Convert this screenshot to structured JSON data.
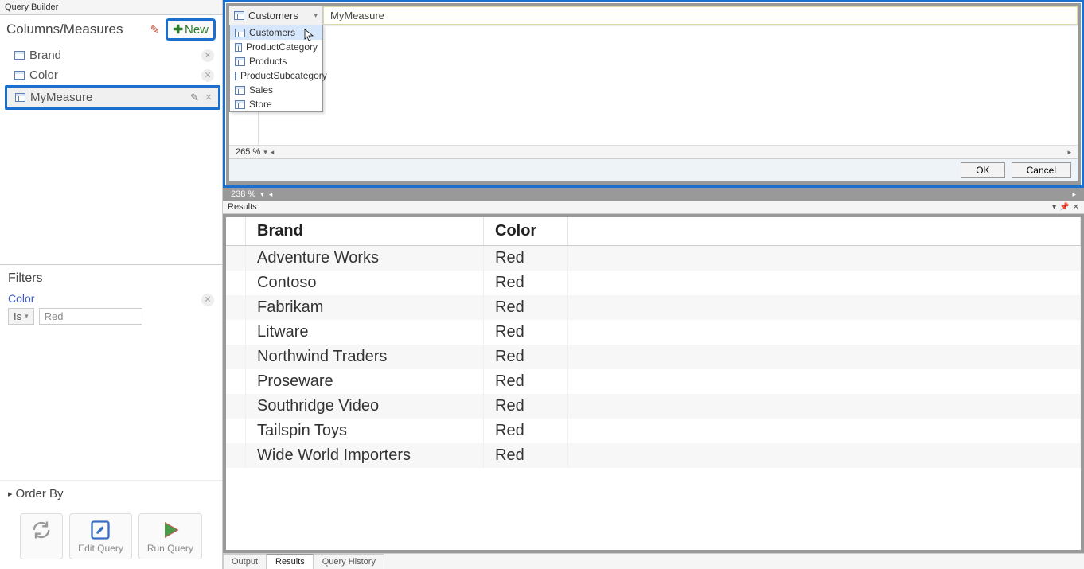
{
  "queryBuilder": {
    "title": "Query Builder",
    "columnsHeader": "Columns/Measures",
    "newLabel": "New",
    "items": [
      {
        "label": "Brand",
        "type": "column"
      },
      {
        "label": "Color",
        "type": "column"
      },
      {
        "label": "MyMeasure",
        "type": "measure"
      }
    ],
    "filtersHeader": "Filters",
    "filter": {
      "field": "Color",
      "op": "Is",
      "value": "Red"
    },
    "orderByLabel": "Order By",
    "editQueryLabel": "Edit Query",
    "runQueryLabel": "Run Query"
  },
  "formula": {
    "selectedTable": "Customers",
    "expression": "MyMeasure",
    "dropdown": [
      "Customers",
      "ProductCategory",
      "Products",
      "ProductSubcategory",
      "Sales",
      "Store"
    ],
    "zoom": "265 %",
    "okLabel": "OK",
    "cancelLabel": "Cancel",
    "strip": "238 %"
  },
  "results": {
    "title": "Results",
    "columns": [
      "Brand",
      "Color"
    ],
    "rows": [
      [
        "Adventure Works",
        "Red"
      ],
      [
        "Contoso",
        "Red"
      ],
      [
        "Fabrikam",
        "Red"
      ],
      [
        "Litware",
        "Red"
      ],
      [
        "Northwind Traders",
        "Red"
      ],
      [
        "Proseware",
        "Red"
      ],
      [
        "Southridge Video",
        "Red"
      ],
      [
        "Tailspin Toys",
        "Red"
      ],
      [
        "Wide World Importers",
        "Red"
      ]
    ]
  },
  "tabs": {
    "output": "Output",
    "results": "Results",
    "history": "Query History"
  }
}
